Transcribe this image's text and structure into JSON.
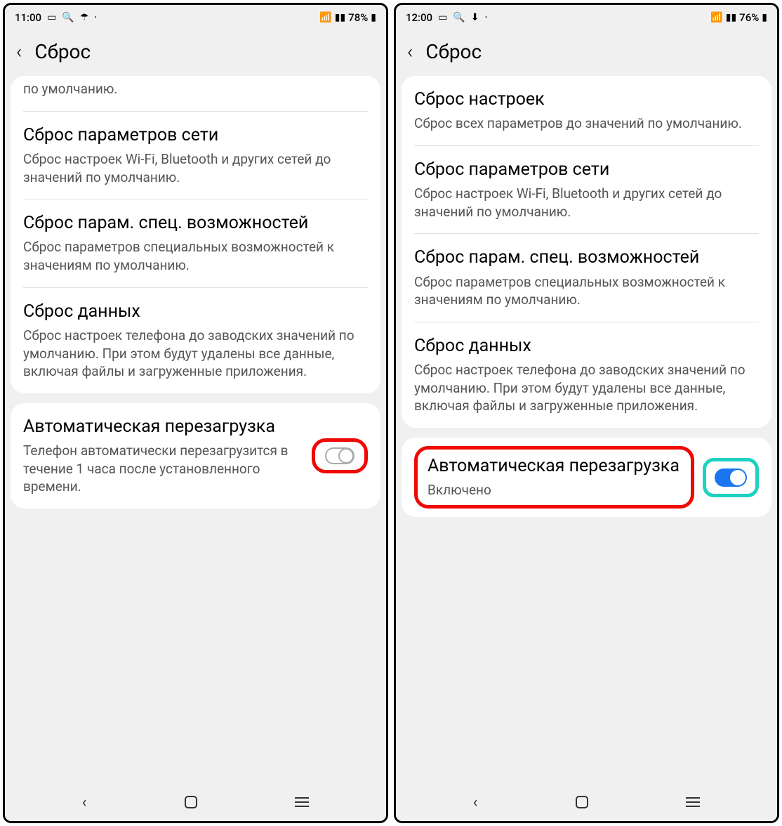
{
  "left": {
    "status": {
      "time": "11:00",
      "battery": "78%"
    },
    "header": "Сброс",
    "partial_sub": "по умолчанию.",
    "items": [
      {
        "title": "Сброс параметров сети",
        "sub": "Сброс настроек Wi-Fi, Bluetooth и других сетей до значений по умолчанию."
      },
      {
        "title": "Сброс парам. спец. возможностей",
        "sub": "Сброс параметров специальных возможностей к значениям по умолчанию."
      },
      {
        "title": "Сброс данных",
        "sub": "Сброс настроек телефона до заводских значений по умолчанию. При этом будут удалены все данные, включая файлы и загруженные приложения."
      }
    ],
    "auto": {
      "title": "Автоматическая перезагрузка",
      "sub": "Телефон автоматически перезагрузится в течение 1 часа после установленного времени."
    }
  },
  "right": {
    "status": {
      "time": "12:00",
      "battery": "76%"
    },
    "header": "Сброс",
    "items": [
      {
        "title": "Сброс настроек",
        "sub": "Сброс всех параметров до значений по умолчанию."
      },
      {
        "title": "Сброс параметров сети",
        "sub": "Сброс настроек Wi-Fi, Bluetooth и других сетей до значений по умолчанию."
      },
      {
        "title": "Сброс парам. спец. возможностей",
        "sub": "Сброс параметров специальных возможностей к значениям по умолчанию."
      },
      {
        "title": "Сброс данных",
        "sub": "Сброс настроек телефона до заводских значений по умолчанию. При этом будут удалены все данные, включая файлы и загруженные приложения."
      }
    ],
    "auto": {
      "title": "Автоматическая перезагрузка",
      "sub": "Включено"
    }
  }
}
